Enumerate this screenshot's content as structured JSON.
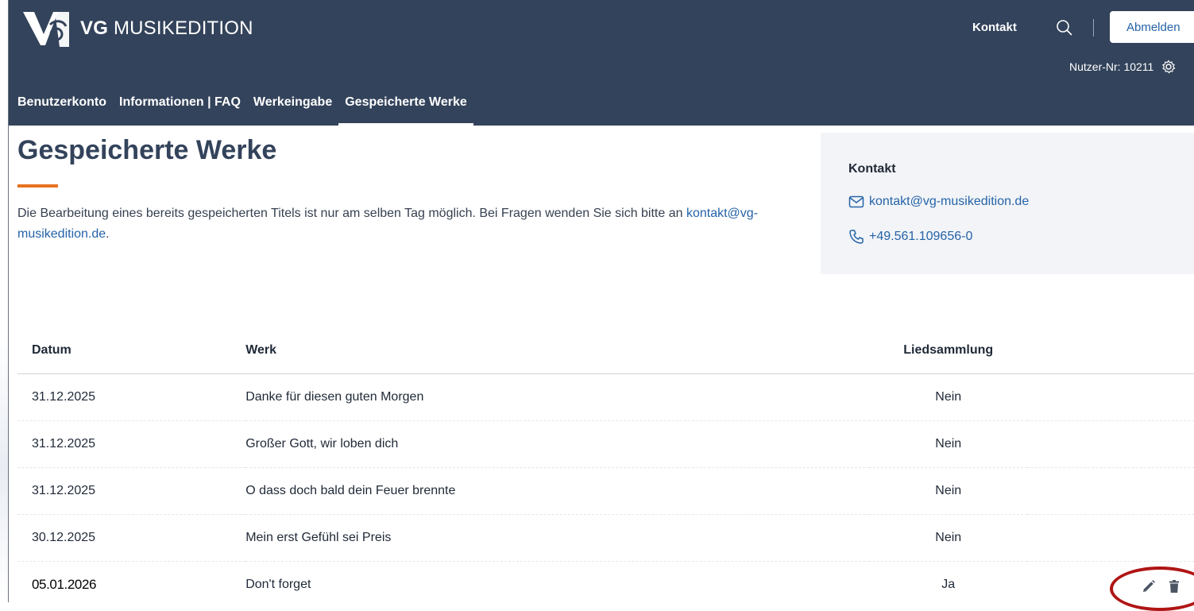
{
  "brand": {
    "bold": "VG",
    "rest": " MUSIKEDITION",
    "logo_icon": "vg-musikedition-logo-icon"
  },
  "header": {
    "contact_link": "Kontakt",
    "search_icon": "search-icon",
    "logout_button": "Abmelden",
    "user_number": "Nutzer-Nr: 10211",
    "settings_icon": "gear-icon"
  },
  "nav": {
    "tabs": [
      {
        "label": "Benutzerkonto",
        "active": false
      },
      {
        "label": "Informationen | FAQ",
        "active": false
      },
      {
        "label": "Werkeingabe",
        "active": false
      },
      {
        "label": "Gespeicherte Werke",
        "active": true
      }
    ]
  },
  "page": {
    "title": "Gespeicherte Werke",
    "intro_text": "Die Bearbeitung eines bereits gespeicherten Titels ist nur am selben Tag möglich. Bei Fragen wenden Sie sich bitte an ",
    "intro_link": "kontakt@vg-musikedition.de",
    "intro_end": "."
  },
  "contact_card": {
    "title": "Kontakt",
    "email": "kontakt@vg-musikedition.de",
    "email_icon": "mail-icon",
    "phone": "+49.561.109656-0",
    "phone_icon": "phone-icon"
  },
  "table": {
    "headers": {
      "date": "Datum",
      "work": "Werk",
      "collection": "Liedsammlung"
    },
    "rows": [
      {
        "date": "31.12.2025",
        "work": "Danke für diesen guten Morgen",
        "collection": "Nein"
      },
      {
        "date": "31.12.2025",
        "work": "Großer Gott, wir loben dich",
        "collection": "Nein"
      },
      {
        "date": "31.12.2025",
        "work": "O dass doch bald dein Feuer brennte",
        "collection": "Nein"
      },
      {
        "date": "30.12.2025",
        "work": "Mein erst Gefühl sei Preis",
        "collection": "Nein"
      },
      {
        "date": "05.01.2026",
        "work": "Don't forget",
        "collection": "Ja",
        "edit_icon": "pencil-icon",
        "delete_icon": "trash-icon"
      }
    ]
  },
  "colors": {
    "header_bg": "#33435b",
    "accent": "#e8711f",
    "link": "#2563a8",
    "highlight": "#b01515"
  }
}
